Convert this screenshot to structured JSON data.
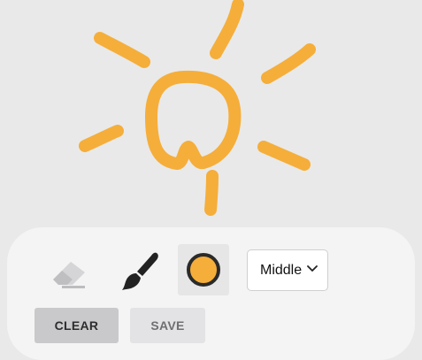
{
  "drawing": {
    "stroke_color": "#f5ae3a",
    "subject": "sun-sketch"
  },
  "toolbar": {
    "eraser_icon": "eraser-icon",
    "brush_icon": "paintbrush-icon",
    "color_swatch": "#f5ae3a",
    "size_select": {
      "selected": "Middle",
      "chevron_icon": "chevron-down-icon"
    },
    "clear_label": "CLEAR",
    "save_label": "SAVE"
  }
}
